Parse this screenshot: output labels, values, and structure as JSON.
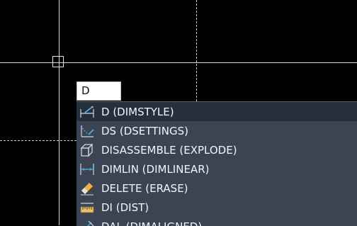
{
  "command_line": {
    "input_value": "D"
  },
  "autocomplete": {
    "items": [
      {
        "label": "D (DIMSTYLE)",
        "icon": "dimstyle-icon"
      },
      {
        "label": "DS (DSETTINGS)",
        "icon": "drafting-settings-icon"
      },
      {
        "label": "DISASSEMBLE (EXPLODE)",
        "icon": "explode-cube-icon"
      },
      {
        "label": "DIMLIN (DIMLINEAR)",
        "icon": "linear-dimension-icon"
      },
      {
        "label": "DELETE (ERASE)",
        "icon": "eraser-icon"
      },
      {
        "label": "DI (DIST)",
        "icon": "ruler-icon"
      },
      {
        "label": "DAL (DIMALIGNED)",
        "icon": "aligned-dimension-icon"
      }
    ],
    "selected_index": 0
  },
  "colors": {
    "canvas_bg": "#000000",
    "panel_bg": "#3b4453",
    "selected_bg": "#26303d",
    "item_text": "#f3f5f8",
    "icon_blue": "#4aa3df"
  }
}
